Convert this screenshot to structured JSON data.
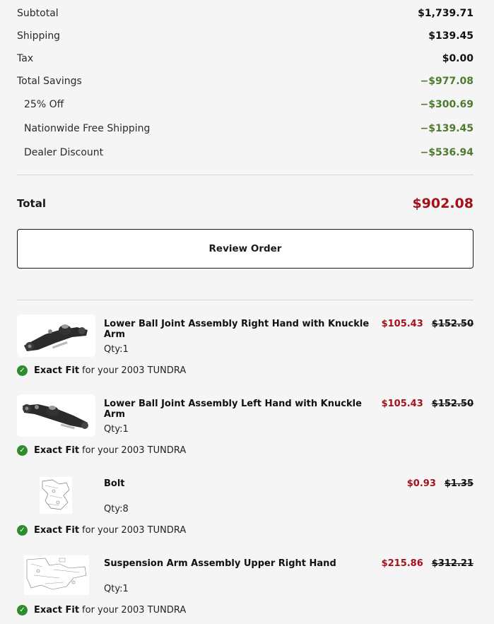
{
  "summary": {
    "subtotal_label": "Subtotal",
    "subtotal_value": "$1,739.71",
    "shipping_label": "Shipping",
    "shipping_value": "$139.45",
    "tax_label": "Tax",
    "tax_value": "$0.00",
    "savings_label": "Total Savings",
    "savings_value": "−$977.08",
    "discounts": [
      {
        "label": "25% Off",
        "value": "−$300.69"
      },
      {
        "label": "Nationwide Free Shipping",
        "value": "−$139.45"
      },
      {
        "label": "Dealer Discount",
        "value": "−$536.94"
      }
    ],
    "total_label": "Total",
    "total_value": "$902.08",
    "savings_color": "#4f7a2e",
    "total_color": "#a4111a"
  },
  "review_button": "Review Order",
  "items": [
    {
      "name": "Lower Ball Joint Assembly Right Hand with Knuckle Arm",
      "qty": "Qty:1",
      "sale_price": "$105.43",
      "orig_price": "$152.50",
      "fit_label": "Exact Fit",
      "fit_text": "for your 2003 TUNDRA",
      "image_icon": "ball-joint-right-image"
    },
    {
      "name": "Lower Ball Joint Assembly Left Hand with Knuckle Arm",
      "qty": "Qty:1",
      "sale_price": "$105.43",
      "orig_price": "$152.50",
      "fit_label": "Exact Fit",
      "fit_text": "for your 2003 TUNDRA",
      "image_icon": "ball-joint-left-image"
    },
    {
      "name": "Bolt",
      "qty": "Qty:8",
      "sale_price": "$0.93",
      "orig_price": "$1.35",
      "fit_label": "Exact Fit",
      "fit_text": "for your 2003 TUNDRA",
      "image_icon": "parts-diagram-image"
    },
    {
      "name": "Suspension Arm Assembly Upper Right Hand",
      "qty": "Qty:1",
      "sale_price": "$215.86",
      "orig_price": "$312.21",
      "fit_label": "Exact Fit",
      "fit_text": "for your 2003 TUNDRA",
      "image_icon": "parts-diagram-image"
    }
  ]
}
